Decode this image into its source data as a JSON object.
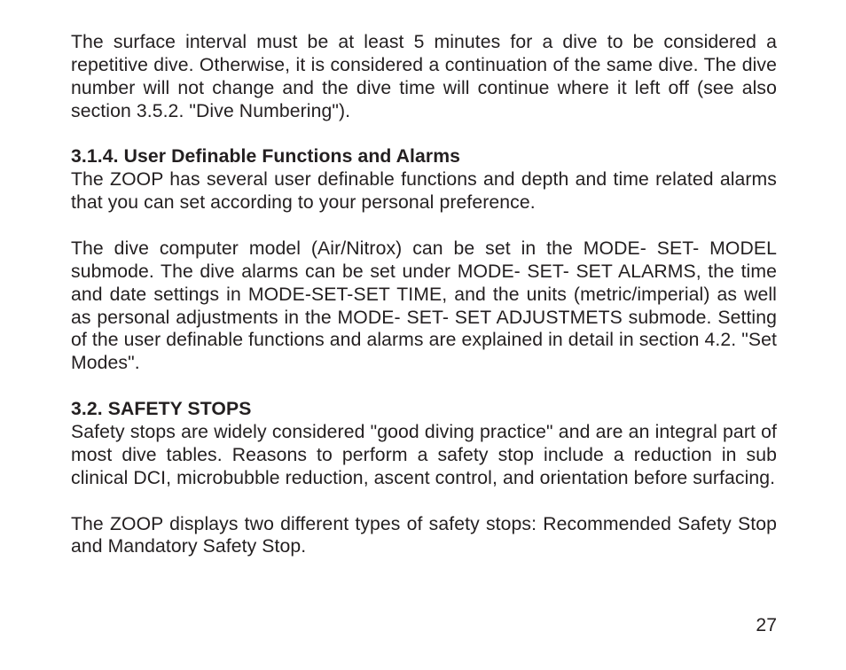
{
  "p1": "The surface interval must be at least 5 minutes for a dive to be considered a repetitive dive. Otherwise, it is considered a continuation of the same dive. The dive number will not change and the dive time will continue where it left off (see also section 3.5.2. \"Dive Numbering\").",
  "h1": "3.1.4. User Definable Functions and Alarms",
  "p2": "The ZOOP has several user definable functions and depth and time related alarms that you can set according to your personal preference.",
  "p3": "The dive computer model (Air/Nitrox) can be set in the MODE- SET- MODEL submode. The dive alarms can be set under MODE- SET- SET ALARMS, the time and date settings in MODE-SET-SET TIME, and the units (metric/imperial) as well as personal adjustments in the MODE- SET- SET ADJUSTMETS submode. Setting of the user definable functions and alarms are explained in detail in section 4.2. \"Set Modes\".",
  "h2": "3.2. SAFETY STOPS",
  "p4": "Safety stops are widely considered \"good diving practice\" and are an integral part of most dive tables. Reasons to perform a safety stop include a reduction in sub clinical DCI, microbubble reduction, ascent control, and orientation before surfacing.",
  "p5": "The ZOOP displays two different types of safety stops: Recommended Safety Stop and Mandatory Safety Stop.",
  "pageNumber": "27"
}
